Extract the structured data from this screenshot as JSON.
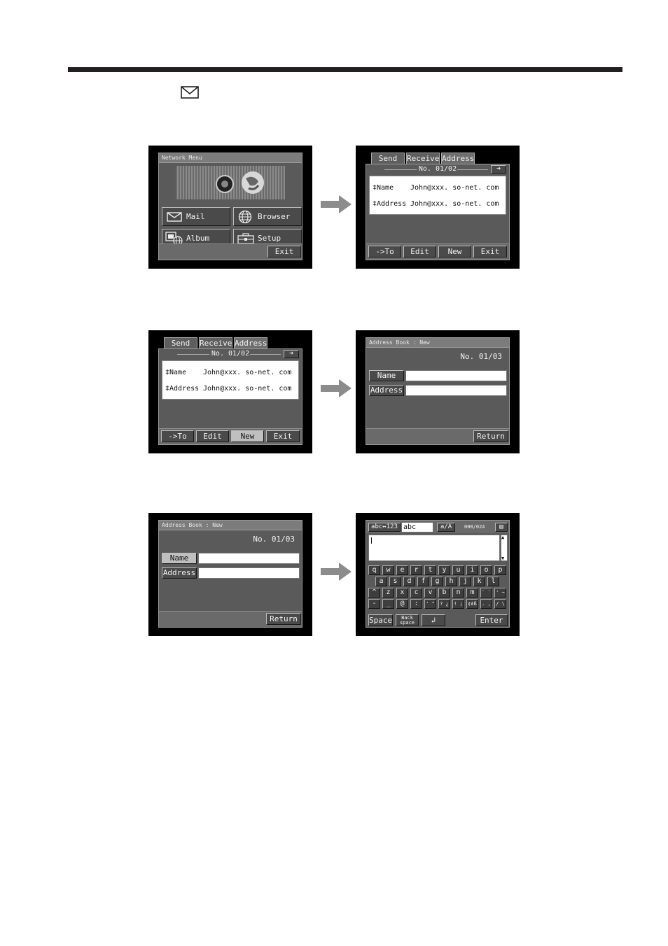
{
  "network_menu": {
    "title": "Network Menu",
    "mail": "Mail",
    "browser": "Browser",
    "album": "Album",
    "setup": "Setup",
    "exit": "Exit"
  },
  "address_list": {
    "tabs": [
      "Send",
      "Receive",
      "Address"
    ],
    "number": "No. 01/02",
    "name_label": "‡Name",
    "name_value": "John@xxx. so-net. com",
    "address_label": "‡Address",
    "address_value": "John@xxx. so-net. com",
    "buttons": [
      "->To",
      "Edit",
      "New",
      "Exit"
    ]
  },
  "address_new": {
    "title": "Address Book : New",
    "number": "No. 01/03",
    "name_label": "Name",
    "address_label": "Address",
    "return": "Return"
  },
  "keyboard": {
    "mode": "abc↔123",
    "input_mode": "abc",
    "case": "a/A",
    "counter": "000/024",
    "row1": [
      "q",
      "w",
      "e",
      "r",
      "t",
      "y",
      "u",
      "i",
      "o",
      "p"
    ],
    "row2": [
      "a",
      "s",
      "d",
      "f",
      "g",
      "h",
      "j",
      "k",
      "l"
    ],
    "row3": [
      "^",
      "z",
      "x",
      "c",
      "v",
      "b",
      "n",
      "m",
      "` `",
      "' ~"
    ],
    "row4": [
      "-",
      "_",
      "@",
      ":",
      "' \"",
      "? ¿",
      "! ¡",
      "¢£ß",
      ". ,",
      "/ \\"
    ],
    "space": "Space",
    "backspace_top": "Back",
    "backspace_bottom": "space",
    "enter": "Enter"
  }
}
